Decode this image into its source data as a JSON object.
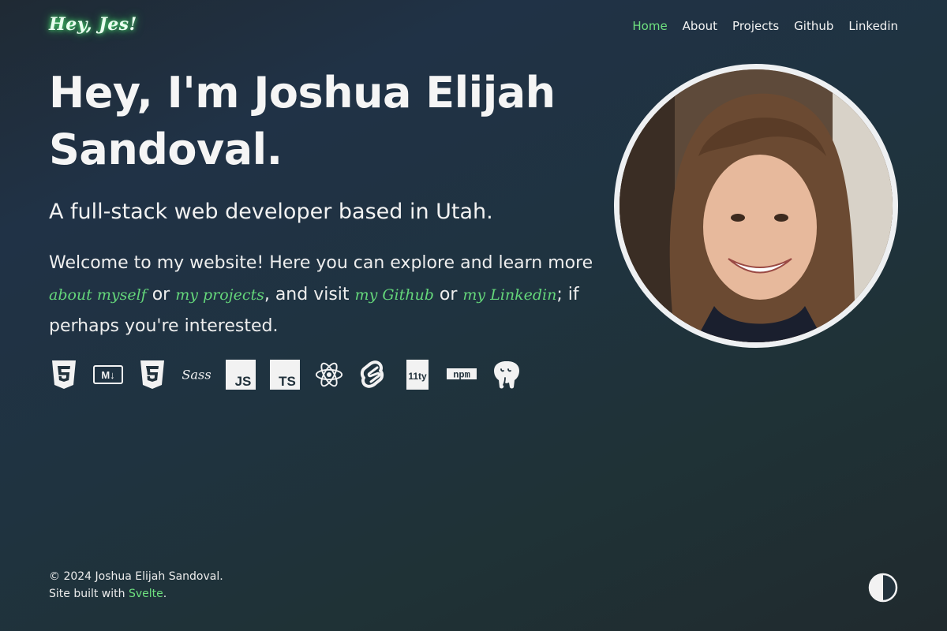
{
  "header": {
    "logo": "Hey, Jes!",
    "nav": [
      {
        "label": "Home",
        "active": true
      },
      {
        "label": "About"
      },
      {
        "label": "Projects"
      },
      {
        "label": "Github"
      },
      {
        "label": "Linkedin"
      }
    ]
  },
  "hero": {
    "title_line1": "Hey, I'm Joshua Elijah",
    "title_line2": "Sandoval.",
    "subtitle": "A full-stack web developer based in Utah.",
    "intro": {
      "text1": "Welcome to my website! Here you can explore and learn more ",
      "link_about": "about myself",
      "text2": " or ",
      "link_projects": "my projects",
      "text3": ", and visit ",
      "link_github": "my Github",
      "text4": " or ",
      "link_linkedin": "my Linkedin",
      "text5": "; if perhaps you're interested."
    },
    "tech_icons": [
      "html5-icon",
      "markdown-icon",
      "css3-icon",
      "sass-icon",
      "javascript-icon",
      "typescript-icon",
      "react-icon",
      "svelte-icon",
      "eleventy-icon",
      "npm-icon",
      "postgresql-icon"
    ],
    "tech_labels": {
      "markdown": "M↓",
      "sass": "Sass",
      "js": "JS",
      "ts": "TS",
      "eleventy": "11ty",
      "npm": "npm"
    }
  },
  "footer": {
    "copyright": "© 2024 Joshua Elijah Sandoval.",
    "built_with": "Site built with ",
    "framework_link": "Svelte",
    "period": "."
  },
  "colors": {
    "accent": "#6ee07f",
    "link": "#64d67a",
    "background_start": "#1f2a34",
    "background_end": "#202a2e"
  }
}
